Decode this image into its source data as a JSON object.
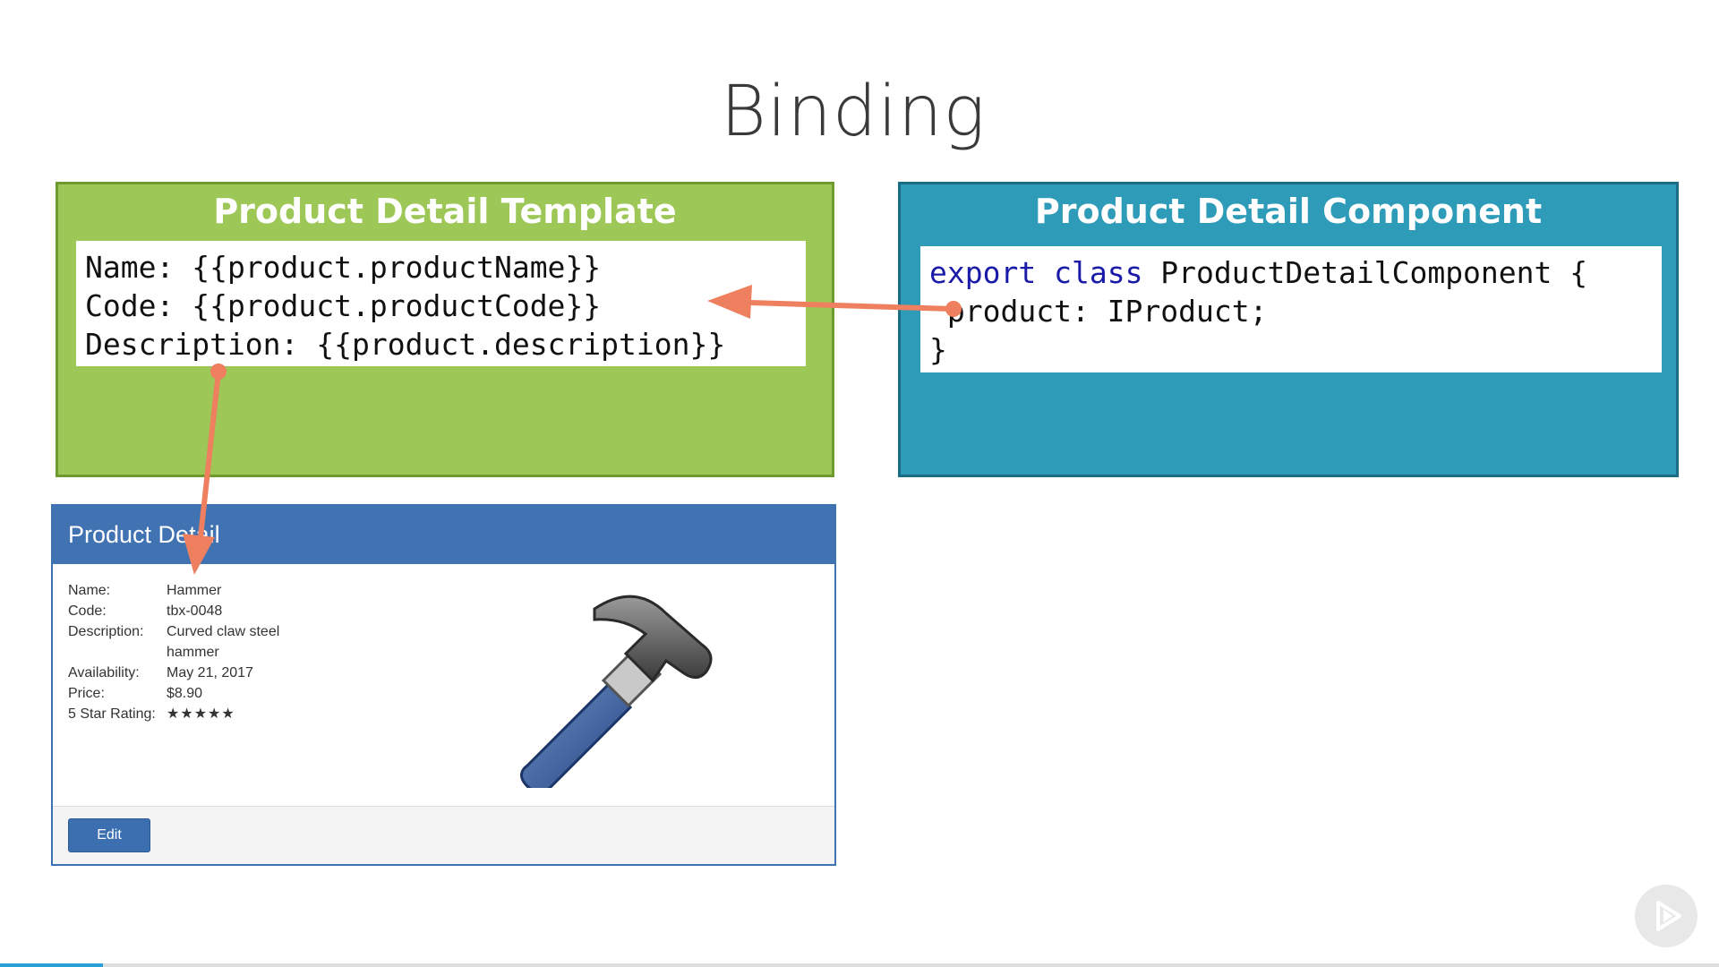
{
  "slide": {
    "title": "Binding"
  },
  "template_panel": {
    "title": "Product Detail Template",
    "lines": [
      "Name: {{product.productName}}",
      "Code: {{product.productCode}}",
      "Description: {{product.description}}"
    ]
  },
  "component_panel": {
    "title": "Product Detail Component",
    "line1": {
      "keyword1": "export",
      "keyword2": "class",
      "rest": " ProductDetailComponent {"
    },
    "line2": " product: IProduct;",
    "line3": "}"
  },
  "product_card": {
    "header": "Product Detail",
    "rows": [
      {
        "label": "Name:",
        "value": "Hammer"
      },
      {
        "label": "Code:",
        "value": "tbx-0048"
      },
      {
        "label": "Description:",
        "value": "Curved claw steel hammer"
      },
      {
        "label": "Availability:",
        "value": "May 21, 2017"
      },
      {
        "label": "Price:",
        "value": "$8.90"
      },
      {
        "label": "5 Star Rating:",
        "value": "★★★★★"
      }
    ],
    "edit_button": "Edit"
  },
  "colors": {
    "template_green": "#9dc757",
    "component_teal": "#2e9bb8",
    "arrow": "#ee7f5f",
    "card_header": "#4173b2"
  },
  "icons": {
    "product_image": "hammer-icon",
    "player": "play-icon"
  },
  "player": {
    "progress_fraction": 0.06
  }
}
